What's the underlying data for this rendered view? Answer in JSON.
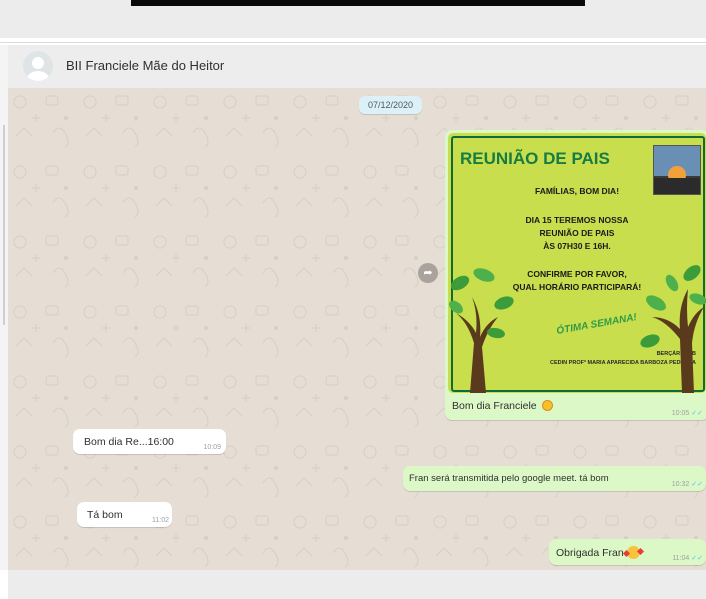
{
  "chat": {
    "contact_name": "BII Franciele Mãe do Heitor",
    "date_chip": "07/12/2020",
    "image_message": {
      "caption": "Bom dia Franciele",
      "time": "10:05",
      "ticks": "✓✓",
      "poster": {
        "title": "REUNIÃO DE PAIS",
        "line1": "FAMÍLIAS, BOM DIA!",
        "line2": "DIA 15 TEREMOS NOSSA",
        "line3": "REUNIÃO DE PAIS",
        "line4": "ÀS 07H30 E 16H.",
        "line5": "CONFIRME POR FAVOR,",
        "line6": "QUAL HORÁRIO PARTICIPARÁ!",
        "closing": "ÓTIMA SEMANA!",
        "footer1": "BERÇÁRIO II B",
        "footer2": "CEDIN PROFª MARIA APARECIDA BARBOZA PEDROZA"
      }
    },
    "messages": [
      {
        "direction": "in",
        "text": "Bom dia Re...16:00",
        "time": "10:09"
      },
      {
        "direction": "out",
        "text": "Fran será transmitida pelo google meet. tá bom",
        "time": "10:32",
        "ticks": "✓✓"
      },
      {
        "direction": "in",
        "text": "Tá bom",
        "time": "11:02"
      },
      {
        "direction": "out",
        "text": "Obrigada Fran",
        "time": "11:04",
        "ticks": "✓✓"
      }
    ]
  },
  "icons": {
    "avatar": "default-avatar-icon",
    "forward": "forward-arrow-icon",
    "caption_emoji": "sunflower-emoji",
    "thanks_emoji": "smiling-face-with-hearts-emoji"
  },
  "colors": {
    "chat_background": "#e6ddd4",
    "incoming_bubble": "#ffffff",
    "outgoing_bubble": "#dcf8c6",
    "read_ticks": "#4fc3f7",
    "date_chip": "#dcf0f8",
    "poster_background": "#c8de4c",
    "poster_title": "#167c43"
  }
}
